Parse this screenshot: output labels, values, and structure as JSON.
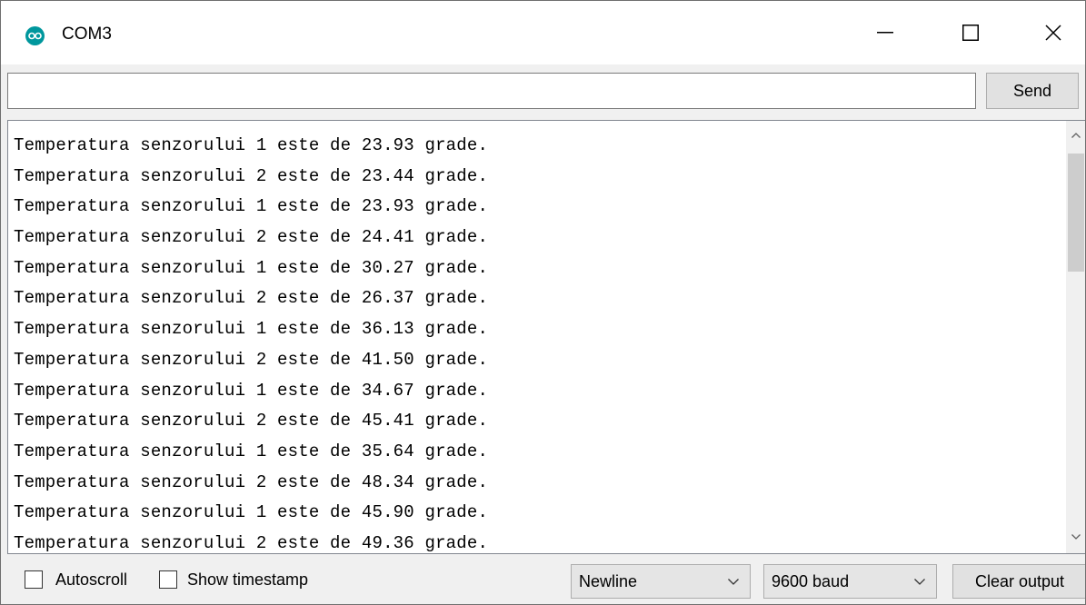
{
  "window": {
    "title": "COM3",
    "icon": "arduino-icon",
    "accent": "#00979d"
  },
  "send": {
    "input_value": "",
    "button_label": "Send"
  },
  "output": {
    "lines": [
      "Temperatura senzorului 1 este de 23.93 grade.",
      "Temperatura senzorului 2 este de 23.44 grade.",
      "Temperatura senzorului 1 este de 23.93 grade.",
      "Temperatura senzorului 2 este de 24.41 grade.",
      "Temperatura senzorului 1 este de 30.27 grade.",
      "Temperatura senzorului 2 este de 26.37 grade.",
      "Temperatura senzorului 1 este de 36.13 grade.",
      "Temperatura senzorului 2 este de 41.50 grade.",
      "Temperatura senzorului 1 este de 34.67 grade.",
      "Temperatura senzorului 2 este de 45.41 grade.",
      "Temperatura senzorului 1 este de 35.64 grade.",
      "Temperatura senzorului 2 este de 48.34 grade.",
      "Temperatura senzorului 1 este de 45.90 grade.",
      "Temperatura senzorului 2 este de 49.36 grade."
    ]
  },
  "bottom": {
    "autoscroll_label": "Autoscroll",
    "autoscroll_checked": false,
    "timestamp_label": "Show timestamp",
    "timestamp_checked": false,
    "line_ending": "Newline",
    "baud_rate": "9600 baud",
    "clear_label": "Clear output"
  }
}
